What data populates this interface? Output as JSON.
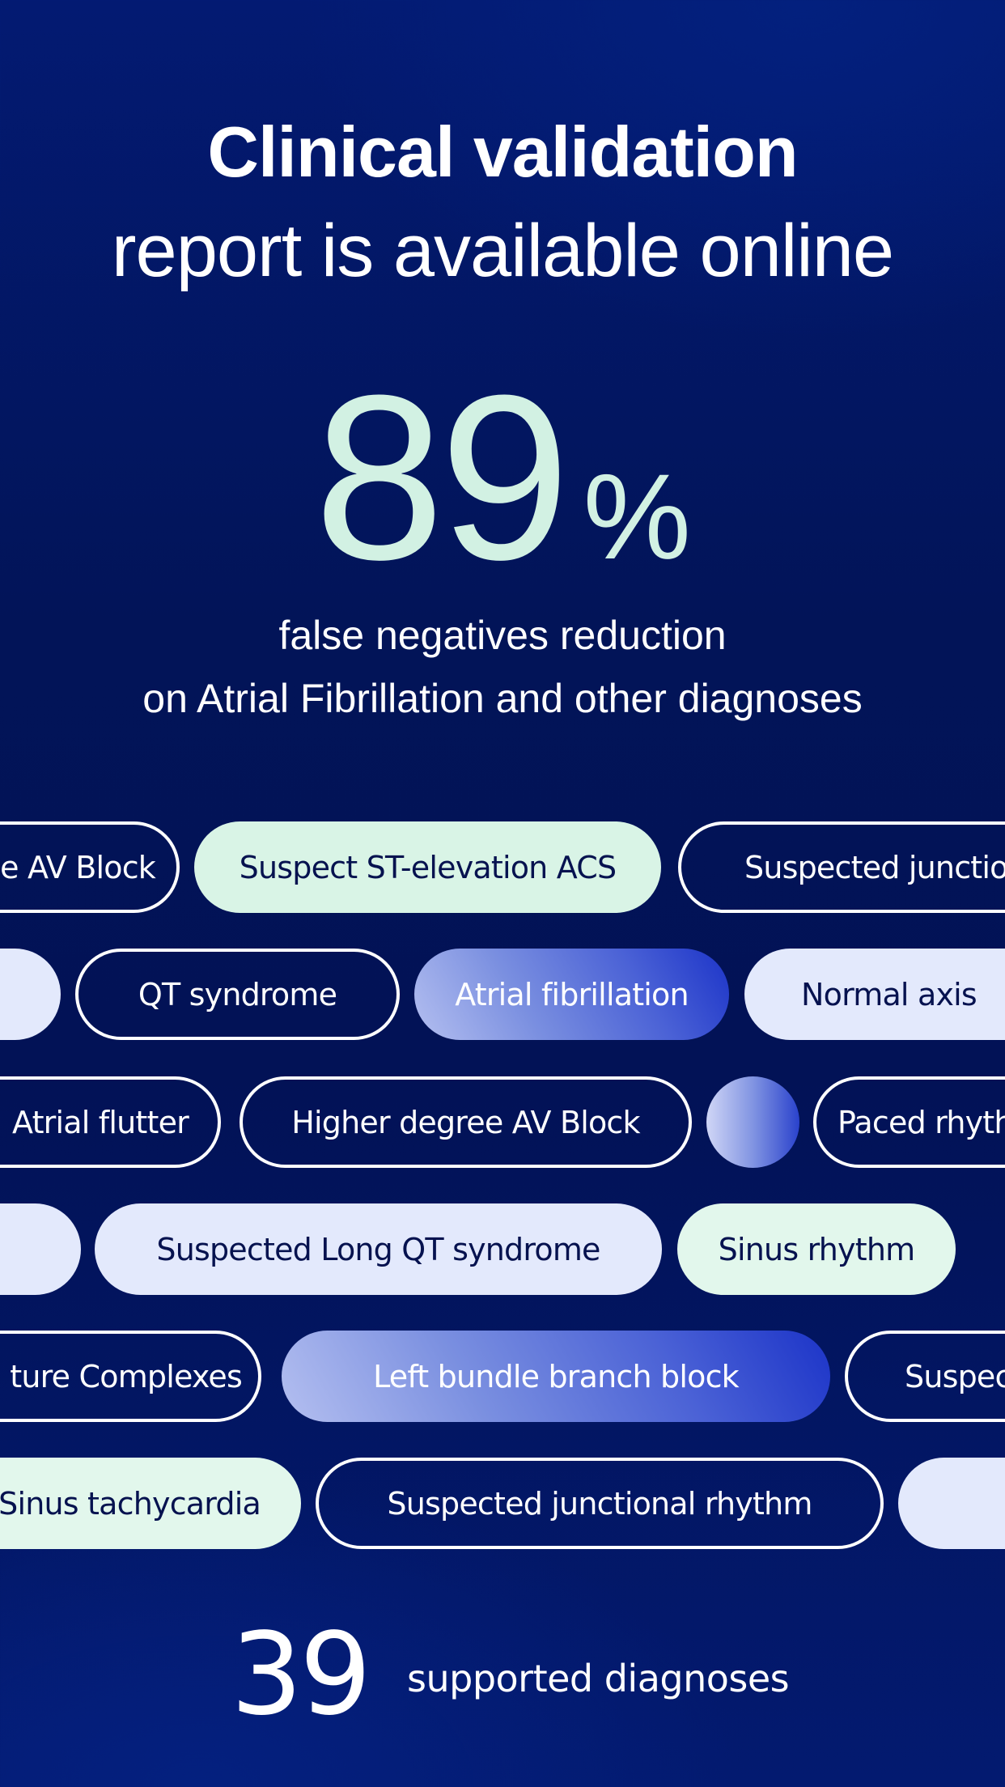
{
  "header": {
    "title_bold": "Clinical validation",
    "title_light": "report is available online"
  },
  "stat": {
    "value": "89",
    "unit": "%",
    "description_line1": "false negatives reduction",
    "description_line2": "on Atrial Fibrillation and other diagnoses"
  },
  "pills": {
    "row1": [
      {
        "label": "e AV Block",
        "style": "outline"
      },
      {
        "label": "Suspect ST-elevation ACS",
        "style": "mint"
      },
      {
        "label": "Suspected junctio",
        "style": "outline"
      }
    ],
    "row2": [
      {
        "label": "",
        "style": "lavender"
      },
      {
        "label": "QT syndrome",
        "style": "outline"
      },
      {
        "label": "Atrial fibrillation",
        "style": "gradient"
      },
      {
        "label": "Normal axis",
        "style": "lavender"
      }
    ],
    "row3": [
      {
        "label": "Atrial flutter",
        "style": "outline"
      },
      {
        "label": "Higher degree AV Block",
        "style": "outline"
      },
      {
        "label": "",
        "style": "gradient-circle"
      },
      {
        "label": "Paced rhyth",
        "style": "outline"
      }
    ],
    "row4": [
      {
        "label": "",
        "style": "lavender"
      },
      {
        "label": "Suspected Long QT syndrome",
        "style": "lavender"
      },
      {
        "label": "Sinus rhythm",
        "style": "mint"
      }
    ],
    "row5": [
      {
        "label": "ture Complexes",
        "style": "outline"
      },
      {
        "label": "Left bundle branch block",
        "style": "gradient"
      },
      {
        "label": "Suspec",
        "style": "outline"
      }
    ],
    "row6": [
      {
        "label": "Sinus tachycardia",
        "style": "mint"
      },
      {
        "label": "Suspected junctional rhythm",
        "style": "outline"
      },
      {
        "label": "",
        "style": "lavender"
      }
    ]
  },
  "footer": {
    "count": "39",
    "label": "supported diagnoses"
  },
  "colors": {
    "background": "#021458",
    "accent_mint": "#d2f1e3",
    "pill_mint": "#d9f4e6",
    "pill_lavender": "#e3e9fc",
    "gradient_start": "#b4bff0",
    "gradient_end": "#1c34c8",
    "text_dark": "#06124f"
  }
}
